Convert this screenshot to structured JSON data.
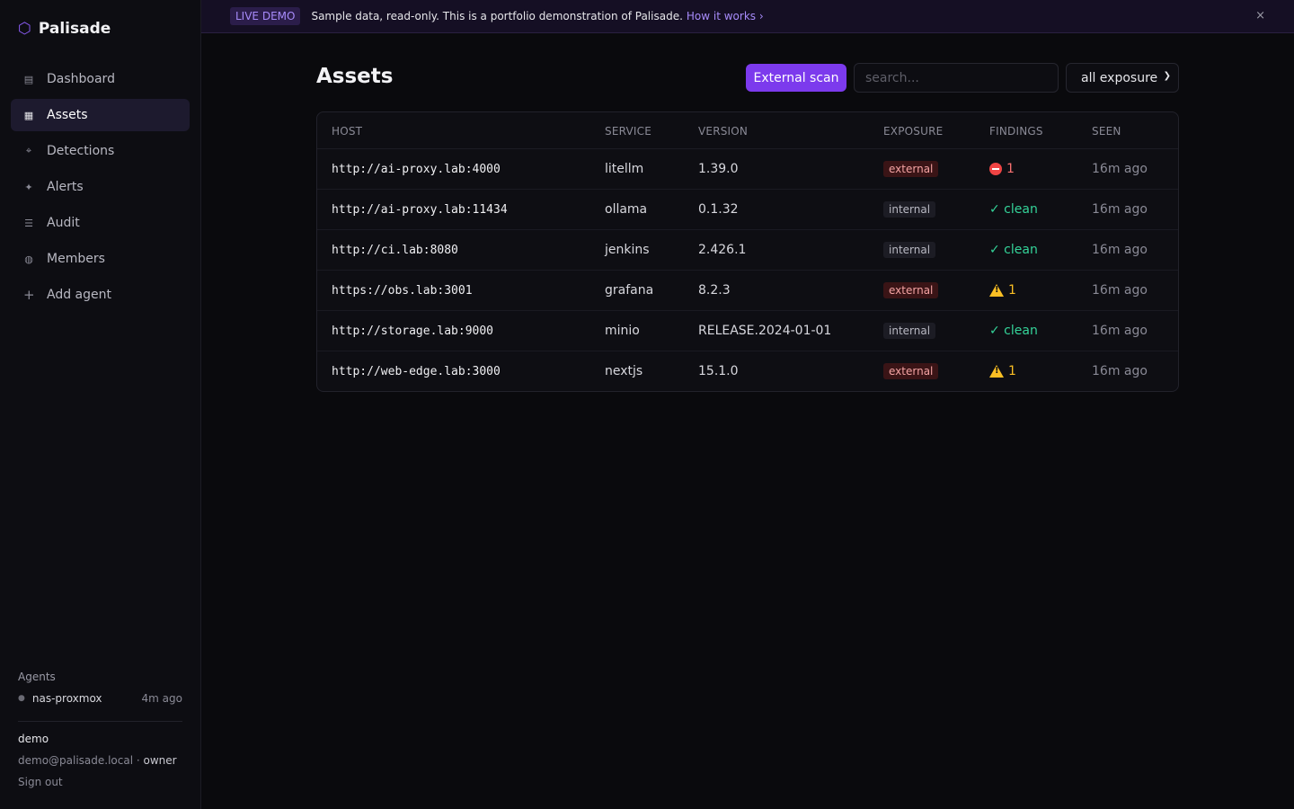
{
  "brand": {
    "name": "Palisade",
    "icon": "hexagon-icon"
  },
  "nav": [
    {
      "label": "Dashboard",
      "icon": "dashboard-icon",
      "active": false
    },
    {
      "label": "Assets",
      "icon": "grid-icon",
      "active": true
    },
    {
      "label": "Detections",
      "icon": "detections-icon",
      "active": false
    },
    {
      "label": "Alerts",
      "icon": "sparkle-icon",
      "active": false
    },
    {
      "label": "Audit",
      "icon": "list-icon",
      "active": false
    },
    {
      "label": "Members",
      "icon": "globe-icon",
      "active": false
    },
    {
      "label": "Add agent",
      "icon": "plus-icon",
      "active": false
    }
  ],
  "agents": {
    "title": "Agents",
    "items": [
      {
        "name": "nas-proxmox",
        "last_seen": "4m ago"
      }
    ]
  },
  "user": {
    "name": "demo",
    "email": "demo@palisade.local",
    "separator": " · ",
    "role": "owner",
    "sign_out": "Sign out"
  },
  "banner": {
    "badge": "LIVE DEMO",
    "text": "Sample data, read-only. This is a portfolio demonstration of Palisade.",
    "link": "How it works ›",
    "close": "×"
  },
  "page": {
    "title": "Assets",
    "scan_button": "External scan",
    "search_placeholder": "search...",
    "filter_value": "all exposure"
  },
  "table": {
    "headers": {
      "host": "HOST",
      "service": "SERVICE",
      "version": "VERSION",
      "exposure": "EXPOSURE",
      "findings": "FINDINGS",
      "seen": "SEEN"
    },
    "rows": [
      {
        "host": "http://ai-proxy.lab:4000",
        "service": "litellm",
        "version": "1.39.0",
        "exposure": "external",
        "findings": "1",
        "findings_kind": "critical",
        "seen": "16m ago"
      },
      {
        "host": "http://ai-proxy.lab:11434",
        "service": "ollama",
        "version": "0.1.32",
        "exposure": "internal",
        "findings": "✓ clean",
        "findings_kind": "clean",
        "seen": "16m ago"
      },
      {
        "host": "http://ci.lab:8080",
        "service": "jenkins",
        "version": "2.426.1",
        "exposure": "internal",
        "findings": "✓ clean",
        "findings_kind": "clean",
        "seen": "16m ago"
      },
      {
        "host": "https://obs.lab:3001",
        "service": "grafana",
        "version": "8.2.3",
        "exposure": "external",
        "findings": "1",
        "findings_kind": "warn",
        "seen": "16m ago"
      },
      {
        "host": "http://storage.lab:9000",
        "service": "minio",
        "version": "RELEASE.2024-01-01",
        "exposure": "internal",
        "findings": "✓ clean",
        "findings_kind": "clean",
        "seen": "16m ago"
      },
      {
        "host": "http://web-edge.lab:3000",
        "service": "nextjs",
        "version": "15.1.0",
        "exposure": "external",
        "findings": "1",
        "findings_kind": "warn",
        "seen": "16m ago"
      }
    ]
  },
  "colors": {
    "accent": "#7c3aed",
    "external": "#f4a3a3",
    "clean": "#34d399",
    "warn": "#fbbf24",
    "critical": "#ef4444"
  }
}
